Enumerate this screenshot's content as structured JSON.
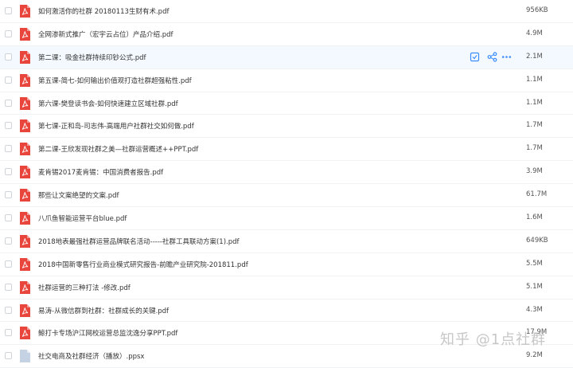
{
  "files": [
    {
      "name": "如何激活你的社群 20180113生财有术.pdf",
      "size": "956KB",
      "type": "pdf"
    },
    {
      "name": "全网渗新式推广（宏宇云占位）产品介绍.pdf",
      "size": "4.9M",
      "type": "pdf"
    },
    {
      "name": "第二课：吸金社群持续印钞公式.pdf",
      "size": "2.1M",
      "type": "pdf",
      "highlighted": true
    },
    {
      "name": "第五课-简七-如何输出价值观打造社群超强粘性.pdf",
      "size": "1.1M",
      "type": "pdf"
    },
    {
      "name": "第六课-樊登读书会-如何快速建立区域社群.pdf",
      "size": "1.1M",
      "type": "pdf"
    },
    {
      "name": "第七课-正和岛-司志伟-高端用户社群社交如何做.pdf",
      "size": "1.7M",
      "type": "pdf"
    },
    {
      "name": "第二课-王欣发现社群之美—社群运营概述++PPT.pdf",
      "size": "1.7M",
      "type": "pdf"
    },
    {
      "name": "麦肯锡2017麦肯锡：中国消费者报告.pdf",
      "size": "3.9M",
      "type": "pdf"
    },
    {
      "name": "那些让文案绝望的文案.pdf",
      "size": "61.7M",
      "type": "pdf"
    },
    {
      "name": "八爪鱼智能运营平台blue.pdf",
      "size": "1.6M",
      "type": "pdf"
    },
    {
      "name": "2018地表最强社群运营品牌联名活动-----社群工具联动方案(1).pdf",
      "size": "649KB",
      "type": "pdf"
    },
    {
      "name": "2018中国新零售行业商业模式研究报告-前瞻产业研究院-201811.pdf",
      "size": "5.5M",
      "type": "pdf"
    },
    {
      "name": "社群运营的三种打法 -修改.pdf",
      "size": "5.1M",
      "type": "pdf"
    },
    {
      "name": "易涛-从微信群到社群：社群成长的关键.pdf",
      "size": "4.3M",
      "type": "pdf"
    },
    {
      "name": "鲸打卡专场沪江网校运营总监沈逸分享PPT.pdf",
      "size": "17.9M",
      "type": "pdf"
    },
    {
      "name": "社交电商及社群经济（播放）.ppsx",
      "size": "9.2M",
      "type": "ppsx"
    }
  ],
  "row_actions": [
    "save-icon",
    "share-icon",
    "more-icon"
  ],
  "watermark": "知乎 @1点社群",
  "colors": {
    "pdf_icon": "#e8453c",
    "ppsx_icon": "#c4d2e3",
    "accent": "#3b8cff"
  }
}
